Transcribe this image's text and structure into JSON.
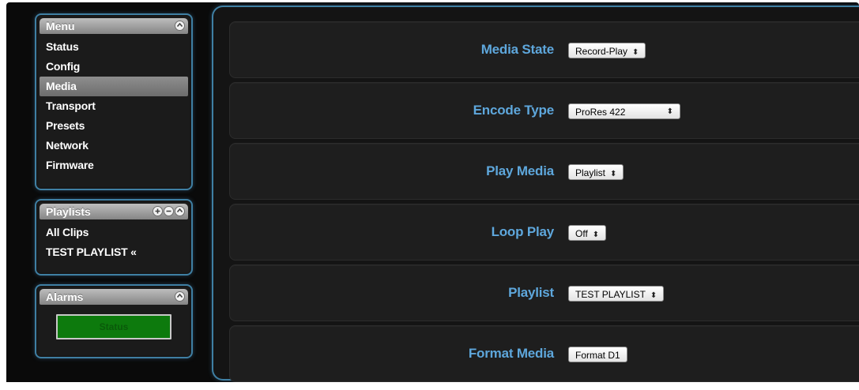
{
  "sidebar": {
    "menu": {
      "title": "Menu",
      "items": [
        {
          "label": "Status"
        },
        {
          "label": "Config"
        },
        {
          "label": "Media",
          "active": true
        },
        {
          "label": "Transport"
        },
        {
          "label": "Presets"
        },
        {
          "label": "Network"
        },
        {
          "label": "Firmware"
        }
      ]
    },
    "playlists": {
      "title": "Playlists",
      "items": [
        {
          "label": "All Clips"
        },
        {
          "label": "TEST PLAYLIST «"
        }
      ]
    },
    "alarms": {
      "title": "Alarms",
      "status_text": "Status",
      "status_color": "#0d7a0d"
    }
  },
  "main": {
    "rows": [
      {
        "label": "Media State",
        "control": "select",
        "value": "Record-Play"
      },
      {
        "label": "Encode Type",
        "control": "select",
        "value": "ProRes 422"
      },
      {
        "label": "Play Media",
        "control": "select",
        "value": "Playlist"
      },
      {
        "label": "Loop Play",
        "control": "select",
        "value": "Off"
      },
      {
        "label": "Playlist",
        "control": "select",
        "value": "TEST PLAYLIST"
      },
      {
        "label": "Format Media",
        "control": "button",
        "value": "Format D1"
      }
    ]
  },
  "colors": {
    "accent_label": "#5ea7dc",
    "panel_border": "#3f7fa3",
    "background": "#0a0a0a"
  },
  "icons": {
    "collapse": "chevron-up-icon",
    "add": "plus-circle-icon",
    "remove": "minus-circle-icon"
  }
}
